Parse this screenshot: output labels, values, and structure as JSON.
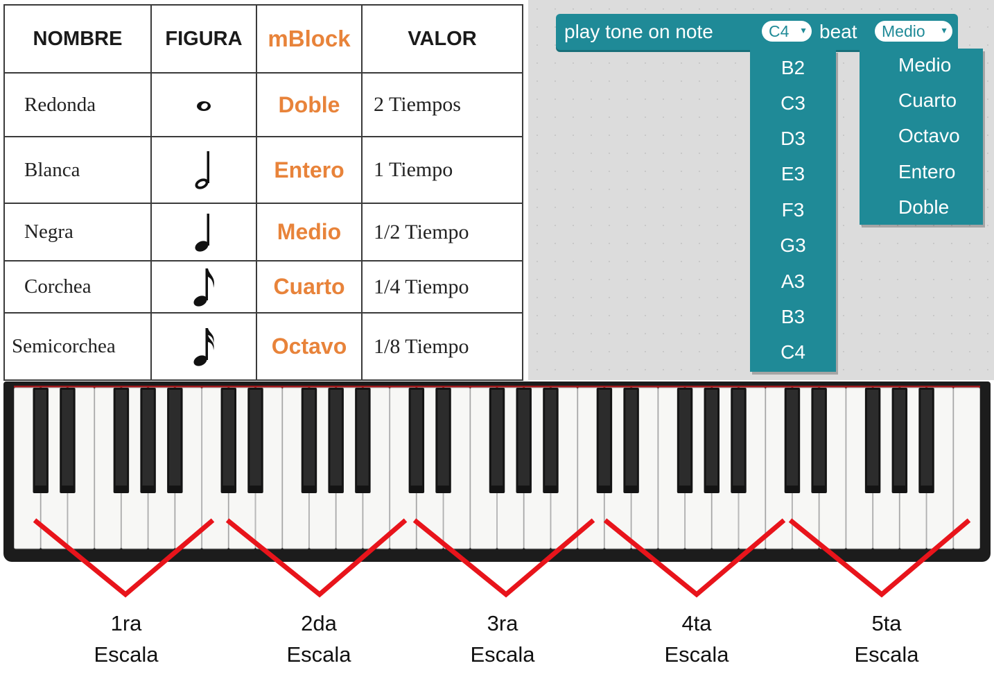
{
  "table": {
    "headers": {
      "name": "NOMBRE",
      "figure": "FIGURA",
      "mblock": "mBlock",
      "value": "VALOR"
    },
    "rows": [
      {
        "name": "Redonda",
        "figure": "whole-note-icon",
        "mblock": "Doble",
        "value": "2 Tiempos"
      },
      {
        "name": "Blanca",
        "figure": "half-note-icon",
        "mblock": "Entero",
        "value": "1 Tiempo"
      },
      {
        "name": "Negra",
        "figure": "quarter-note-icon",
        "mblock": "Medio",
        "value": "1/2 Tiempo"
      },
      {
        "name": "Corchea",
        "figure": "eighth-note-icon",
        "mblock": "Cuarto",
        "value": "1/4 Tiempo"
      },
      {
        "name": "Semicorchea",
        "figure": "sixteenth-note-icon",
        "mblock": "Octavo",
        "value": "1/8 Tiempo"
      }
    ]
  },
  "block": {
    "text_play": "play tone on note",
    "note_value": "C4",
    "text_beat": "beat",
    "beat_value": "Medio",
    "note_options": [
      "B2",
      "C3",
      "D3",
      "E3",
      "F3",
      "G3",
      "A3",
      "B3",
      "C4"
    ],
    "beat_options": [
      "Medio",
      "Cuarto",
      "Octavo",
      "Entero",
      "Doble"
    ],
    "color": "#1f8a97"
  },
  "scales": [
    {
      "num": "1ra",
      "word": "Escala"
    },
    {
      "num": "2da",
      "word": "Escala"
    },
    {
      "num": "3ra",
      "word": "Escala"
    },
    {
      "num": "4ta",
      "word": "Escala"
    },
    {
      "num": "5ta",
      "word": "Escala"
    }
  ],
  "accent_colors": {
    "mblock_orange": "#e8833a",
    "marker_red": "#e8141b"
  }
}
